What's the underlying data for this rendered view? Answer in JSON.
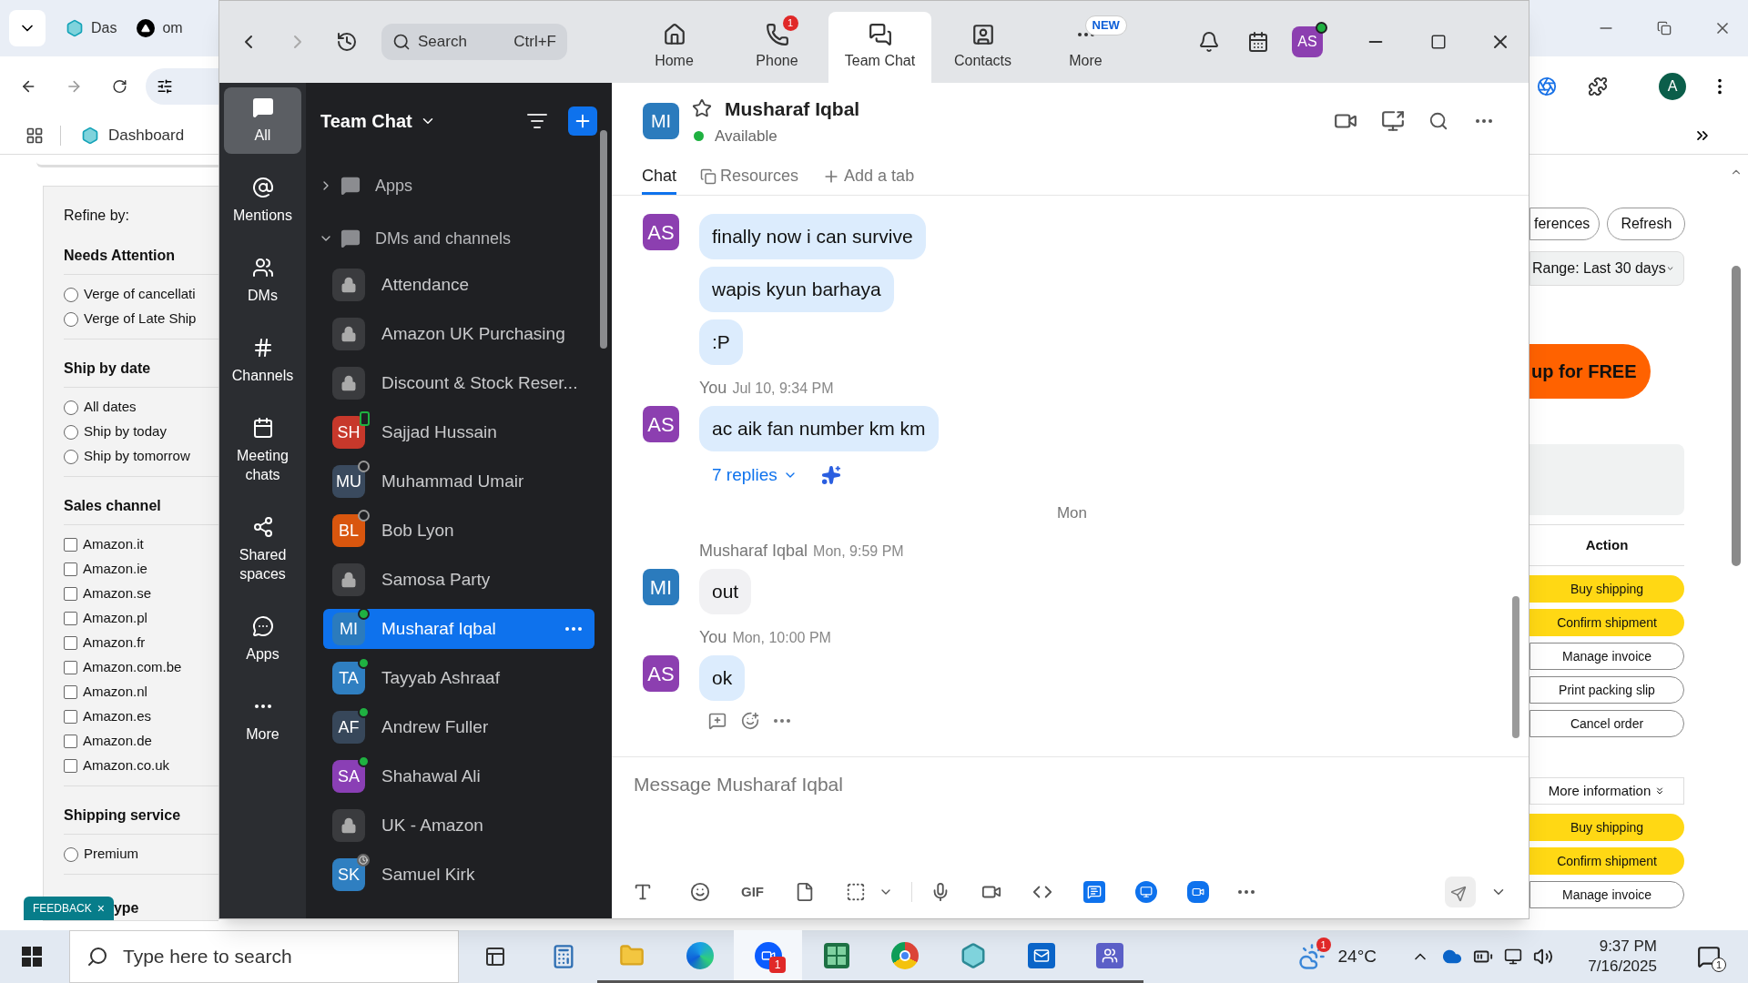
{
  "browser": {
    "tabs": [
      {
        "label": "Das",
        "kind": "hexagon"
      },
      {
        "label": "om",
        "kind": "triangle"
      }
    ],
    "bookmarks": [
      {
        "label": "Dashboard"
      }
    ],
    "profile_initial": "A"
  },
  "left_page": {
    "refine_label": "Refine by:",
    "sections": [
      {
        "title": "Needs Attention",
        "kind": "radio",
        "options": [
          {
            "label": "Verge of cancellati",
            "checked": false
          },
          {
            "label": "Verge of Late Ship",
            "checked": false
          }
        ]
      },
      {
        "title": "Ship by date",
        "kind": "radio",
        "options": [
          {
            "label": "All dates",
            "checked": false
          },
          {
            "label": "Ship by today",
            "checked": false
          },
          {
            "label": "Ship by tomorrow",
            "checked": false
          }
        ]
      },
      {
        "title": "Sales channel",
        "kind": "checkbox",
        "options": [
          {
            "label": "Amazon.it",
            "checked": false
          },
          {
            "label": "Amazon.ie",
            "checked": false
          },
          {
            "label": "Amazon.se",
            "checked": false
          },
          {
            "label": "Amazon.pl",
            "checked": false
          },
          {
            "label": "Amazon.fr",
            "checked": false
          },
          {
            "label": "Amazon.com.be",
            "checked": false
          },
          {
            "label": "Amazon.nl",
            "checked": false
          },
          {
            "label": "Amazon.es",
            "checked": false
          },
          {
            "label": "Amazon.de",
            "checked": false
          },
          {
            "label": "Amazon.co.uk",
            "checked": false
          }
        ]
      },
      {
        "title": "Shipping service",
        "kind": "radio",
        "options": [
          {
            "label": "Premium",
            "checked": false
          }
        ]
      }
    ],
    "partial_heading": "ype",
    "feedback": {
      "label": "FEEDBACK",
      "close": "×"
    }
  },
  "right_page": {
    "top_buttons": [
      {
        "label": "ferences"
      },
      {
        "label": "Refresh"
      }
    ],
    "range": "Range: Last 30 days",
    "promo": "up for FREE",
    "action_header": "Action",
    "actions": [
      {
        "label": "Buy shipping",
        "kind": "primary"
      },
      {
        "label": "Confirm shipment",
        "kind": "primary"
      },
      {
        "label": "Manage invoice",
        "kind": "outline"
      },
      {
        "label": "Print packing slip",
        "kind": "outline"
      },
      {
        "label": "Cancel order",
        "kind": "outline"
      }
    ],
    "more_info": "More information",
    "actions_more": [
      {
        "label": "Buy shipping",
        "kind": "primary"
      },
      {
        "label": "Confirm shipment",
        "kind": "primary"
      },
      {
        "label": "Manage invoice",
        "kind": "outline"
      }
    ]
  },
  "zoom": {
    "search": {
      "placeholder": "Search",
      "shortcut": "Ctrl+F"
    },
    "nav": [
      {
        "label": "Home",
        "kind": "home",
        "selected": false
      },
      {
        "label": "Phone",
        "kind": "phone",
        "selected": false,
        "badge": "1"
      },
      {
        "label": "Team Chat",
        "kind": "chat",
        "selected": true
      },
      {
        "label": "Contacts",
        "kind": "contacts",
        "selected": false
      },
      {
        "label": "More",
        "kind": "more",
        "selected": false,
        "badge": "NEW"
      }
    ],
    "user": {
      "initials": "AS",
      "color": "#8c3fb0",
      "presence": {
        "kind": "available"
      }
    },
    "rail": [
      {
        "label": "All",
        "kind": "all",
        "selected": true
      },
      {
        "label": "Mentions",
        "kind": "mentions",
        "selected": false
      },
      {
        "label": "DMs",
        "kind": "dms",
        "selected": false
      },
      {
        "label": "Channels",
        "kind": "channels",
        "selected": false
      },
      {
        "label": "Meeting chats",
        "kind": "meetings",
        "selected": false
      },
      {
        "label": "Shared spaces",
        "kind": "spaces",
        "selected": false
      },
      {
        "label": "Apps",
        "kind": "apps",
        "selected": false
      },
      {
        "label": "More",
        "kind": "more",
        "selected": false
      }
    ],
    "list": {
      "title": "Team Chat",
      "sections": [
        {
          "label": "Apps",
          "expanded": false
        },
        {
          "label": "DMs and channels",
          "expanded": true,
          "children": [
            {
              "name": "Attendance",
              "kind": "channel",
              "selected": false
            },
            {
              "name": "Amazon UK Purchasing",
              "kind": "channel",
              "selected": false
            },
            {
              "name": "Discount & Stock Reser...",
              "kind": "channel",
              "selected": false
            },
            {
              "name": "Sajjad Hussain",
              "kind": "person",
              "initials": "SH",
              "color": "#c7382b",
              "presence": {
                "kind": "mobile"
              },
              "selected": false
            },
            {
              "name": "Muhammad Umair",
              "kind": "person",
              "initials": "MU",
              "color": "#3a4a5e",
              "presence": {
                "kind": "offline"
              },
              "selected": false
            },
            {
              "name": "Bob Lyon",
              "kind": "person",
              "initials": "BL",
              "color": "#d9560e",
              "presence": {
                "kind": "offline"
              },
              "selected": false
            },
            {
              "name": "Samosa Party",
              "kind": "channel",
              "selected": false
            },
            {
              "name": "Musharaf Iqbal",
              "kind": "person",
              "initials": "MI",
              "color": "#2b7bbd",
              "presence": {
                "kind": "available"
              },
              "selected": true
            },
            {
              "name": "Tayyab Ashraaf",
              "kind": "person",
              "initials": "TA",
              "color": "#2f7fc1",
              "presence": {
                "kind": "available"
              },
              "selected": false
            },
            {
              "name": "Andrew Fuller",
              "kind": "person",
              "initials": "AF",
              "color": "#37475a",
              "presence": {
                "kind": "available"
              },
              "selected": false
            },
            {
              "name": "Shahawal Ali",
              "kind": "person",
              "initials": "SA",
              "color": "#8a3fb5",
              "presence": {
                "kind": "available"
              },
              "selected": false
            },
            {
              "name": "UK - Amazon",
              "kind": "channel",
              "selected": false
            },
            {
              "name": "Samuel Kirk",
              "kind": "person",
              "initials": "SK",
              "color": "#2f7fc1",
              "presence": {
                "kind": "clock"
              },
              "selected": false
            }
          ]
        }
      ]
    },
    "chat": {
      "contact": {
        "initials": "MI",
        "color": "#2b7bbd",
        "name": "Musharaf Iqbal",
        "presence": {
          "kind": "available"
        },
        "status_label": "Available",
        "starred": false
      },
      "tabs": [
        {
          "label": "Chat",
          "kind": "chat",
          "selected": true
        },
        {
          "label": "Resources",
          "kind": "resources",
          "selected": false
        },
        {
          "label": "Add a tab",
          "kind": "add",
          "selected": false
        }
      ],
      "items": [
        {
          "kind": "messages",
          "initials": "AS",
          "color": "#8c3fb0",
          "messages": [
            {
              "text": "finally now i can survive",
              "mine": true
            },
            {
              "text": "wapis kyun barhaya",
              "mine": true
            },
            {
              "text": ":P",
              "mine": true
            }
          ]
        },
        {
          "kind": "messages",
          "sender": "You",
          "time": "Jul 10, 9:34 PM",
          "initials": "AS",
          "color": "#8c3fb0",
          "messages": [
            {
              "text": "ac aik fan number km km",
              "mine": true
            }
          ],
          "replies": "7 replies"
        },
        {
          "kind": "divider",
          "label": "Mon"
        },
        {
          "kind": "messages",
          "sender": "Musharaf Iqbal",
          "time": "Mon, 9:59 PM",
          "initials": "MI",
          "color": "#2b7bbd",
          "messages": [
            {
              "text": "out",
              "mine": false
            }
          ]
        },
        {
          "kind": "messages",
          "sender": "You",
          "time": "Mon, 10:00 PM",
          "initials": "AS",
          "color": "#8c3fb0",
          "messages": [
            {
              "text": "ok",
              "mine": true
            }
          ],
          "actions": true
        }
      ],
      "composer": {
        "placeholder": "Message Musharaf Iqbal",
        "gif_label": "GIF"
      }
    }
  },
  "taskbar": {
    "search_placeholder": "Type here to search",
    "apps": [
      {
        "kind": "taskview",
        "running": false,
        "selected": false
      },
      {
        "kind": "calculator",
        "running": false,
        "selected": false
      },
      {
        "kind": "folder",
        "running": true,
        "selected": false
      },
      {
        "kind": "browser_blue",
        "running": true,
        "selected": false
      },
      {
        "kind": "video",
        "running": true,
        "selected": true,
        "badge": "1"
      },
      {
        "kind": "sheet",
        "running": true,
        "selected": false
      },
      {
        "kind": "browser_round",
        "running": true,
        "selected": false
      },
      {
        "kind": "hexagon",
        "running": true,
        "selected": false
      },
      {
        "kind": "mail",
        "running": true,
        "selected": false
      },
      {
        "kind": "team",
        "running": true,
        "selected": false
      }
    ],
    "weather_badge": "1",
    "temperature": "24°C",
    "time": "9:37 PM",
    "date": "7/16/2025",
    "notifications": "1"
  }
}
